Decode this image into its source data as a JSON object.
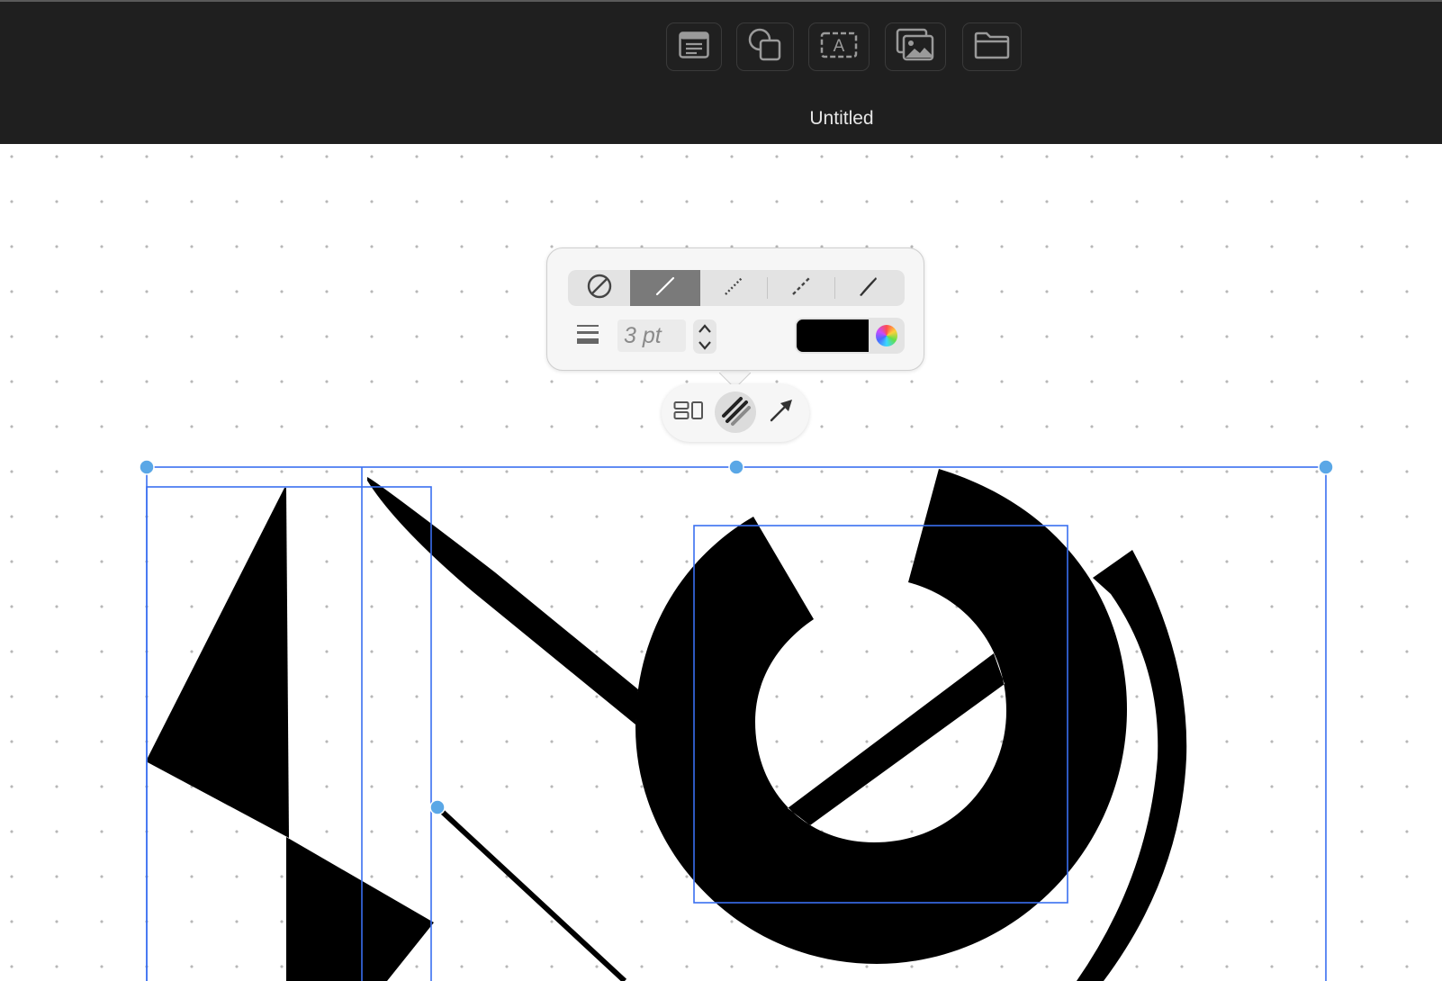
{
  "app": {
    "document_title": "Untitled"
  },
  "toolbar": {
    "buttons": [
      {
        "name": "text-box-button",
        "icon": "text-box-icon"
      },
      {
        "name": "shapes-button",
        "icon": "shapes-icon"
      },
      {
        "name": "text-button",
        "icon": "text-letter-icon"
      },
      {
        "name": "media-button",
        "icon": "photo-gallery-icon"
      },
      {
        "name": "folder-button",
        "icon": "folder-icon"
      }
    ]
  },
  "line_style_popover": {
    "styles": [
      "none",
      "solid",
      "dotted",
      "dashed",
      "brush"
    ],
    "selected_style": "solid",
    "line_width_value": "3 pt",
    "stroke_color": "#000000"
  },
  "context_bar": {
    "buttons": [
      {
        "name": "arrange-button",
        "icon": "arrange-icon"
      },
      {
        "name": "line-style-button",
        "icon": "line-style-icon",
        "active": true
      },
      {
        "name": "arrow-button",
        "icon": "arrow-icon"
      }
    ]
  },
  "colors": {
    "toolbar_bg": "#1f1f1f",
    "selection_accent": "#3a6ff0",
    "handle_color": "#5aa7e6",
    "selected_segment": "#7a7a7a"
  }
}
